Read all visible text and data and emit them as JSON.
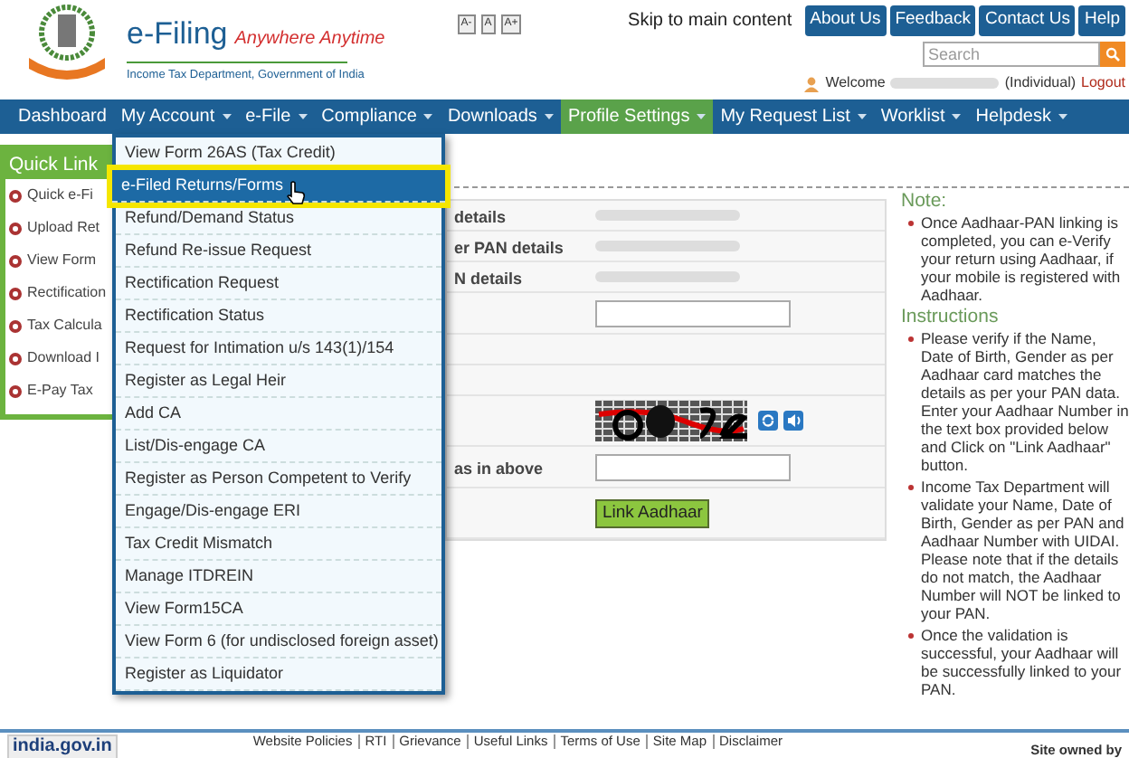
{
  "header": {
    "title": "e-Filing",
    "tagline": "Anywhere Anytime",
    "subtitle": "Income Tax Department, Government of India",
    "font_buttons": [
      "A-",
      "A",
      "A+"
    ],
    "skip_link": "Skip to main content",
    "top_buttons": [
      "About Us",
      "Feedback",
      "Contact Us",
      "Help"
    ],
    "search": {
      "placeholder": "Search"
    },
    "welcome": "Welcome",
    "user_type": "(Individual)",
    "logout": "Logout"
  },
  "nav": [
    {
      "label": "Dashboard",
      "has_menu": false,
      "selected": false
    },
    {
      "label": "My Account",
      "has_menu": true,
      "selected": false
    },
    {
      "label": "e-File",
      "has_menu": true,
      "selected": false
    },
    {
      "label": "Compliance",
      "has_menu": true,
      "selected": false
    },
    {
      "label": "Downloads",
      "has_menu": true,
      "selected": false
    },
    {
      "label": "Profile Settings",
      "has_menu": true,
      "selected": true
    },
    {
      "label": "My Request List",
      "has_menu": true,
      "selected": false
    },
    {
      "label": "Worklist",
      "has_menu": true,
      "selected": false
    },
    {
      "label": "Helpdesk",
      "has_menu": true,
      "selected": false
    }
  ],
  "dropdown": [
    {
      "label": "View Form 26AS (Tax Credit)",
      "selected": false
    },
    {
      "label": "e-Filed Returns/Forms",
      "selected": true
    },
    {
      "label": "Refund/Demand Status",
      "selected": false
    },
    {
      "label": "Refund Re-issue Request",
      "selected": false
    },
    {
      "label": "Rectification Request",
      "selected": false
    },
    {
      "label": "Rectification Status",
      "selected": false
    },
    {
      "label": "Request for Intimation u/s  143(1)/154",
      "selected": false
    },
    {
      "label": "Register as Legal Heir",
      "selected": false
    },
    {
      "label": "Add CA",
      "selected": false
    },
    {
      "label": "List/Dis-engage CA",
      "selected": false
    },
    {
      "label": "Register as Person Competent to Verify",
      "selected": false
    },
    {
      "label": "Engage/Dis-engage ERI",
      "selected": false
    },
    {
      "label": "Tax Credit Mismatch",
      "selected": false
    },
    {
      "label": "Manage ITDREIN",
      "selected": false
    },
    {
      "label": "View Form15CA",
      "selected": false
    },
    {
      "label": "View Form 6 (for undisclosed foreign asset)",
      "selected": false
    },
    {
      "label": "Register as Liquidator",
      "selected": false
    }
  ],
  "quick_links": {
    "title": "Quick Link",
    "items": [
      "Quick e-Fi",
      "Upload Ret",
      "View Form",
      "Rectification",
      "Tax Calcula",
      "Download I",
      "E-Pay Tax"
    ]
  },
  "form": [
    {
      "kind": "detail",
      "label": "details"
    },
    {
      "kind": "detail",
      "label": "er PAN details"
    },
    {
      "kind": "detail",
      "label": "N details"
    },
    {
      "kind": "input"
    },
    {
      "kind": "blank"
    },
    {
      "kind": "blank"
    },
    {
      "kind": "captcha"
    },
    {
      "kind": "input",
      "label": "as in above"
    },
    {
      "kind": "button",
      "label": "Link Aadhaar"
    }
  ],
  "notes": {
    "note_title": "Note:",
    "note_items": [
      "Once Aadhaar-PAN linking is completed, you can e-Verify your return using Aadhaar, if your mobile is registered with Aadhaar."
    ],
    "instructions_title": "Instructions",
    "instruction_items": [
      "Please verify if the Name, Date of Birth, Gender as per Aadhaar card matches the details as per your PAN data. Enter your Aadhaar Number in the text box provided below and Click on \"Link Aadhaar\" button.",
      "Income Tax Department will validate your Name, Date of Birth, Gender as per PAN and Aadhaar Number with UIDAI. Please note that if the details do not match, the Aadhaar Number will NOT be linked to your PAN.",
      "Once the validation is successful, your Aadhaar will be successfully linked to your PAN."
    ]
  },
  "footer": {
    "logo": "india.gov.in",
    "links": [
      "Website Policies",
      "RTI",
      "Grievance",
      "Useful Links",
      "Terms of Use",
      "Site Map",
      "Disclaimer"
    ],
    "owner": "Site owned by"
  }
}
